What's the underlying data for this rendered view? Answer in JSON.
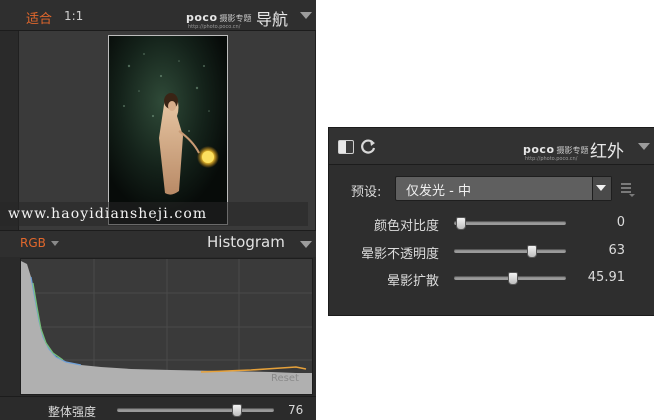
{
  "navigator": {
    "fit_label": "适合",
    "zoom_label": "1:1",
    "logo_text": "poco",
    "logo_sub": "摄影专题",
    "logo_url": "http://photo.poco.cn/",
    "title": "导航",
    "watermark": "www.haoyidiansheji.com"
  },
  "histogram": {
    "channel_label": "RGB",
    "title": "Histogram",
    "reset_label": "Reset",
    "strength": {
      "label": "整体强度",
      "value": "76",
      "level": 0.76
    }
  },
  "infrared_panel": {
    "logo_text": "poco",
    "logo_sub": "摄影专题",
    "logo_url": "http://photo.poco.cn/",
    "title": "红外",
    "preset_label": "预设:",
    "preset_value": "仅发光 - 中",
    "sliders": [
      {
        "label": "颜色对比度",
        "value": "0",
        "level": 0.0
      },
      {
        "label": "晕影不透明度",
        "value": "63",
        "level": 0.63
      },
      {
        "label": "晕影扩散",
        "value": "45.91",
        "level": 0.46
      }
    ]
  },
  "colors": {
    "accent": "#e0672c",
    "panel_bg": "#2a2a2a",
    "histogram_fill": "#b6b6b6"
  },
  "icons": [
    "chevron-down-icon",
    "toggle-icon",
    "refresh-icon",
    "menu-icon"
  ]
}
